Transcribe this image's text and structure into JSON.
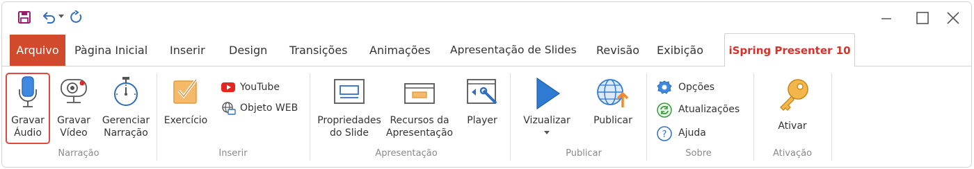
{
  "quick_access": {
    "save_icon": "save-icon",
    "undo_icon": "undo-icon",
    "redo_icon": "redo-icon"
  },
  "window_controls": {
    "minimize_icon": "minimize-icon",
    "maximize_icon": "maximize-icon",
    "close_icon": "close-icon"
  },
  "tabs": {
    "file": "Arquivo",
    "home": "Pàgina Inicial",
    "insert": "Inserir",
    "design": "Design",
    "transitions": "Transições",
    "animations": "Animações",
    "slideshow": "Apresentação de Slides",
    "review": "Revisão",
    "view": "Exibição",
    "ispring": "iSpring Presenter 10"
  },
  "ribbon": {
    "narration": {
      "label": "Narração",
      "record_audio": [
        "Gravar",
        "Áudio"
      ],
      "record_video": [
        "Gravar",
        "Vídeo"
      ],
      "manage_narration": [
        "Gerenciar",
        "Narração"
      ]
    },
    "insert": {
      "label": "Inserir",
      "exercise": "Exercício",
      "youtube": "YouTube",
      "web_object": "Objeto WEB"
    },
    "presentation": {
      "label": "Apresentação",
      "slide_properties": [
        "Propriedades",
        "do Slide"
      ],
      "presentation_resources": [
        "Recursos da",
        "Apresentação"
      ],
      "player": "Player"
    },
    "publish": {
      "label": "Publicar",
      "preview": "Vizualizar",
      "publish": "Publicar"
    },
    "about": {
      "label": "Sobre",
      "options": "Opções",
      "updates": "Atualizações",
      "help": "Ajuda"
    },
    "activation": {
      "label": "Ativação",
      "activate": "Ativar"
    }
  },
  "colors": {
    "accent_red": "#d6322a",
    "file_tab": "#d14a2c",
    "icon_blue": "#2f7bd3"
  }
}
